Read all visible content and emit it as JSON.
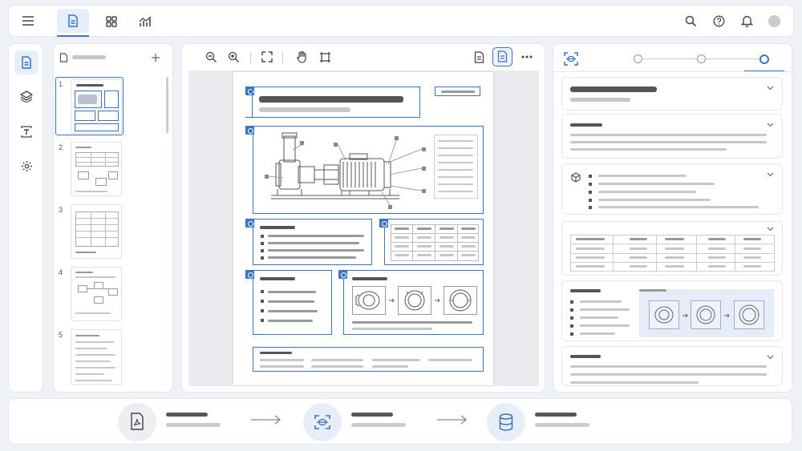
{
  "topbar": {
    "icons": [
      "menu-icon",
      "document-icon",
      "grid-icon",
      "chart-icon",
      "search-icon",
      "help-icon",
      "bell-icon",
      "avatar"
    ]
  },
  "thumbnails": {
    "pages": [
      "1",
      "2",
      "3",
      "4",
      "5"
    ],
    "selected": "1"
  },
  "colors": {
    "accent": "#3a72c4",
    "panel": "#ffffff",
    "background": "#eef1f6"
  },
  "pipeline": {
    "steps": [
      "pdf-icon",
      "scan-icon",
      "database-icon"
    ]
  },
  "progress": {
    "steps": 3,
    "active": 3
  }
}
